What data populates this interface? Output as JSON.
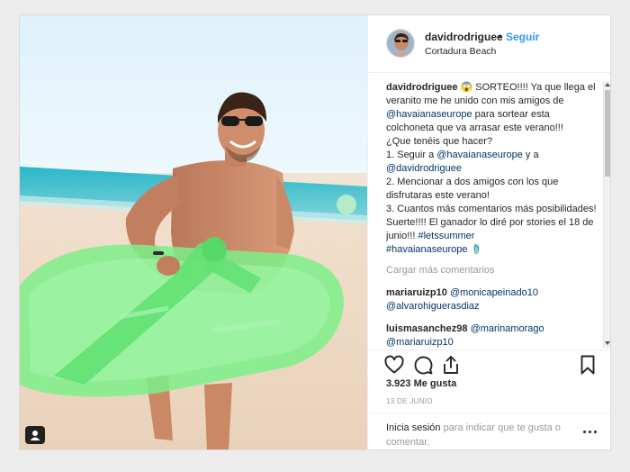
{
  "header": {
    "username": "davidrodriguee",
    "separator": "•",
    "follow_label": "Seguir",
    "location": "Cortadura Beach"
  },
  "caption": {
    "username": "davidrodriguee",
    "text": " 😱 SORTEO!!!! Ya que llega el veranito me he unido con mis amigos de ",
    "mention1": "@havaianaseurope",
    "text2": " para sortear esta colchoneta que va arrasar este verano!!!\n¿Que tenéis que hacer?\n1. Seguir a ",
    "mention2": "@havaianaseurope",
    "text3": " y a ",
    "mention3": "@davidrodriguee",
    "text4": "\n2. Mencionar a dos amigos con los que disfrutaras este verano!\n3. Cuantos más comentarios más posibilidades!\nSuerte!!!! El ganador lo diré por stories el 18 de junio!!! ",
    "hashtag1": "#letssummer",
    "text5": "\n",
    "hashtag2": "#havaianaseurope",
    "text6": " 🩴"
  },
  "load_more_label": "Cargar más comentarios",
  "comments": [
    {
      "username": "mariaruizp10",
      "text": "@monicapeinado10 @alvarohigueras​diaz"
    },
    {
      "username": "luismasanchez98",
      "text": "@marinamorago @mariaruizp10"
    }
  ],
  "likes": "3.923 Me gusta",
  "date": "13 DE JUNIO",
  "login": {
    "link_label": "Inicia sesión",
    "rest": " para indicar que te gusta o comentar."
  },
  "icons": {
    "like": "heart-icon",
    "comment": "comment-icon",
    "share": "share-icon",
    "save": "bookmark-icon",
    "options": "more-options-icon",
    "tagged": "user-tag-icon"
  },
  "colors": {
    "accent": "#3897f0",
    "link": "#003569",
    "muted": "#999999",
    "float": "#7df089"
  }
}
